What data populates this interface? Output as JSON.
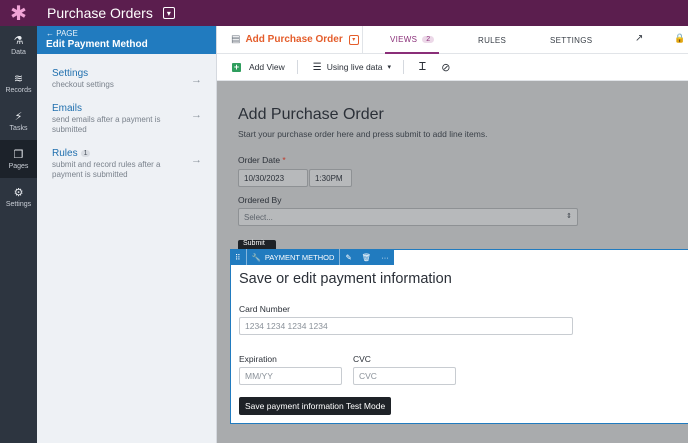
{
  "app": {
    "logo": "✱",
    "title": "Purchase Orders",
    "title_chevron": "▾"
  },
  "rail": [
    {
      "icon": "⚗",
      "label": "Data"
    },
    {
      "icon": "≋",
      "label": "Records"
    },
    {
      "icon": "⚡",
      "label": "Tasks"
    },
    {
      "icon": "❐",
      "label": "Pages"
    },
    {
      "icon": "⚙",
      "label": "Settings"
    }
  ],
  "panel": {
    "back": "← PAGE",
    "title": "Edit Payment Method",
    "items": [
      {
        "title": "Settings",
        "sub": "checkout settings",
        "arrow": "→"
      },
      {
        "title": "Emails",
        "sub": "send emails after a payment is submitted",
        "arrow": "→"
      },
      {
        "title": "Rules",
        "badge": "1",
        "sub": "submit and record rules after a payment is submitted",
        "arrow": "→"
      }
    ]
  },
  "editor": {
    "page_icon": "▤",
    "page_name": "Add Purchase Order",
    "page_dropdown": "▾",
    "tabs": {
      "views": "VIEWS",
      "views_count": "2",
      "rules": "RULES",
      "settings": "SETTINGS"
    },
    "external_icon": "↗",
    "lock_icon": "🔒"
  },
  "toolbar": {
    "add_view_icon": "+",
    "add_view": "Add View",
    "db_icon": "☰",
    "live_data": "Using live data",
    "live_data_caret": "▾",
    "text_cursor_icon": "Ꮖ",
    "hide_icon": "⊘"
  },
  "form": {
    "title": "Add Purchase Order",
    "subtitle": "Start your purchase order here and press submit to add line items.",
    "order_date_label": "Order Date",
    "required_mark": "*",
    "date_value": "10/30/2023",
    "time_value": "1:30PM",
    "ordered_by_label": "Ordered By",
    "ordered_by_placeholder": "Select...",
    "select_arrows": "⇕",
    "submit_peek": "Submit"
  },
  "payment_block": {
    "toolbar": {
      "drag_icon": "⠿",
      "wrench_icon": "🔧",
      "label": "PAYMENT METHOD",
      "edit_icon": "✎",
      "delete_icon": "🗑",
      "more_icon": "···"
    },
    "heading": "Save or edit payment information",
    "card_label": "Card Number",
    "card_placeholder": "1234 1234 1234 1234",
    "exp_label": "Expiration",
    "exp_placeholder": "MM/YY",
    "cvc_label": "CVC",
    "cvc_placeholder": "CVC",
    "button": "Save payment information Test Mode"
  }
}
